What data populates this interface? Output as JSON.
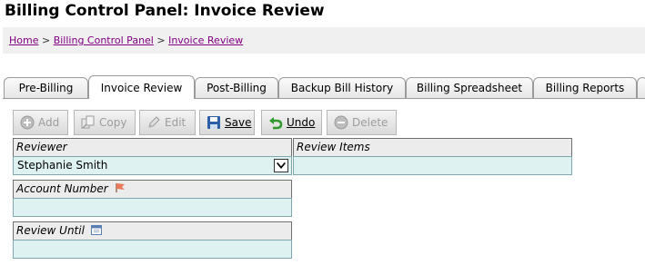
{
  "page": {
    "title": "Billing Control Panel: Invoice Review"
  },
  "breadcrumb": {
    "items": [
      "Home",
      "Billing Control Panel",
      "Invoice Review"
    ],
    "separator": ">"
  },
  "tabs": [
    {
      "label": "Pre-Billing"
    },
    {
      "label": "Invoice Review"
    },
    {
      "label": "Post-Billing"
    },
    {
      "label": "Backup Bill History"
    },
    {
      "label": "Billing Spreadsheet"
    },
    {
      "label": "Billing Reports"
    }
  ],
  "toolbar": {
    "add_label": "Add",
    "copy_label": "Copy",
    "edit_label": "Edit",
    "save_label": "Save",
    "undo_label": "Undo",
    "delete_label": "Delete"
  },
  "fields": {
    "reviewer": {
      "label": "Reviewer",
      "value": "Stephanie Smith"
    },
    "review_items": {
      "label": "Review Items",
      "value": ""
    },
    "account_number": {
      "label": "Account Number",
      "value": ""
    },
    "review_until": {
      "label": "Review Until",
      "value": ""
    }
  },
  "colors": {
    "link": "#800080",
    "field_bg": "#dff2f2",
    "label_bg": "#ececec",
    "undo_green": "#2e9a2e",
    "save_blue": "#2c5fa8"
  },
  "icons": {
    "add": "plus-circle-icon",
    "copy": "copy-icon",
    "edit": "pencil-icon",
    "save": "floppy-disk-icon",
    "undo": "undo-arrow-icon",
    "delete": "minus-circle-icon",
    "account_number": "flag-icon",
    "review_until": "calendar-icon"
  }
}
